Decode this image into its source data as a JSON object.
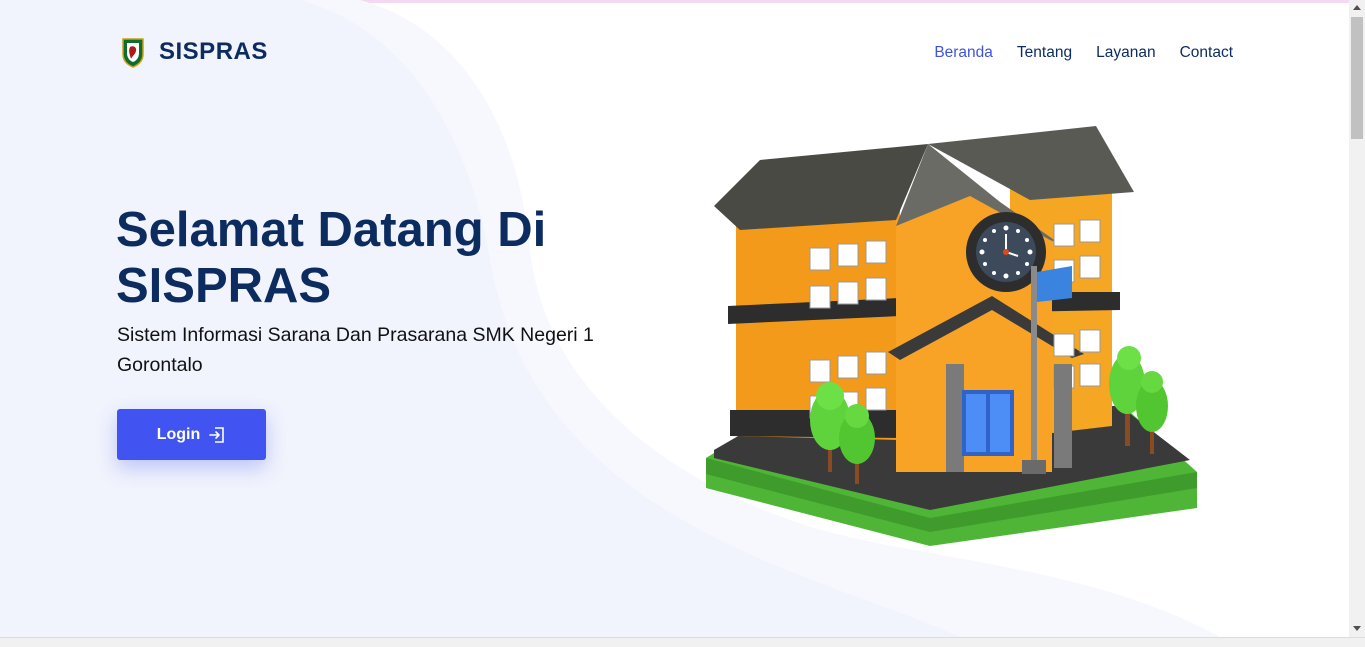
{
  "brand": {
    "name": "SISPRAS",
    "logo_icon": "school-emblem-icon"
  },
  "nav": {
    "items": [
      {
        "label": "Beranda",
        "active": true
      },
      {
        "label": "Tentang",
        "active": false
      },
      {
        "label": "Layanan",
        "active": false
      },
      {
        "label": "Contact",
        "active": false
      }
    ]
  },
  "hero": {
    "title": "Selamat Datang Di SISPRAS",
    "subtitle": "Sistem Informasi Sarana Dan Prasarana SMK Negeri 1 Gorontalo",
    "login_label": "Login",
    "login_icon": "box-arrow-in-right-icon",
    "illustration_icon": "school-building-icon"
  },
  "colors": {
    "primary": "#4154f1",
    "heading": "#0c2b5f",
    "nav_active": "#4154d6",
    "background_blob": "#f1f4fc"
  }
}
